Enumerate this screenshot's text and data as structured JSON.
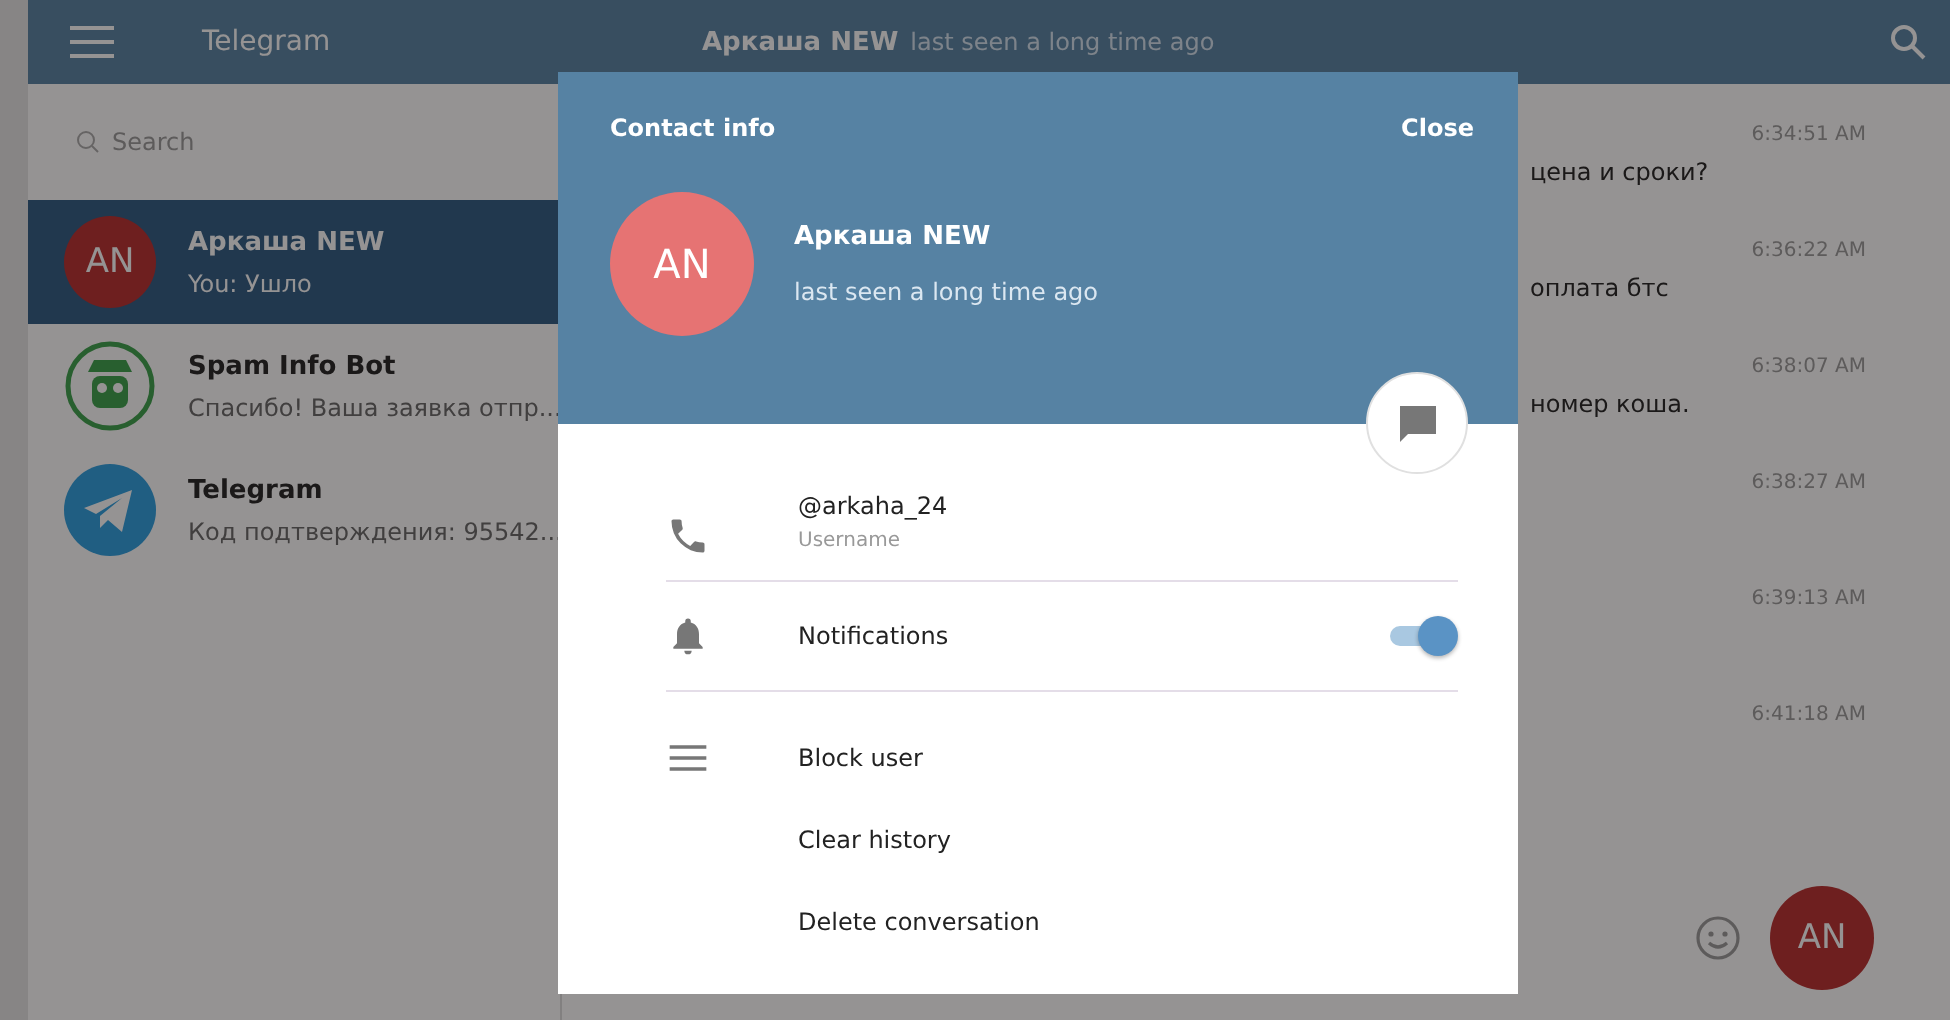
{
  "header": {
    "app_title": "Telegram",
    "chat_name": "Аркаша NEW",
    "chat_status": "last seen a long time ago"
  },
  "search": {
    "placeholder": "Search"
  },
  "chats": [
    {
      "initials": "AN",
      "kind": "initials",
      "name": "Аркаша NEW",
      "preview": "You: Ушло",
      "selected": true
    },
    {
      "kind": "bot",
      "name": "Spam Info Bot",
      "preview": "Спасибо! Ваша заявка отпр...",
      "selected": false
    },
    {
      "kind": "plane",
      "name": "Telegram",
      "preview": "Код подтверждения: 95542...",
      "selected": false
    }
  ],
  "messages": [
    {
      "time": "6:34:51 AM",
      "text": "цена и сроки?"
    },
    {
      "time": "6:36:22 AM",
      "text": "оплата бтс"
    },
    {
      "time": "6:38:07 AM",
      "text": "номер коша."
    },
    {
      "time": "6:38:27 AM"
    },
    {
      "time": "6:39:13 AM"
    },
    {
      "time": "6:41:18 AM"
    }
  ],
  "composer": {
    "initials": "AN"
  },
  "modal": {
    "title": "Contact info",
    "close": "Close",
    "initials": "AN",
    "name": "Аркаша NEW",
    "status": "last seen a long time ago",
    "username": "@arkaha_24",
    "username_label": "Username",
    "notifications": {
      "label": "Notifications",
      "on": true
    },
    "actions": [
      "Block user",
      "Clear history",
      "Delete conversation"
    ]
  }
}
